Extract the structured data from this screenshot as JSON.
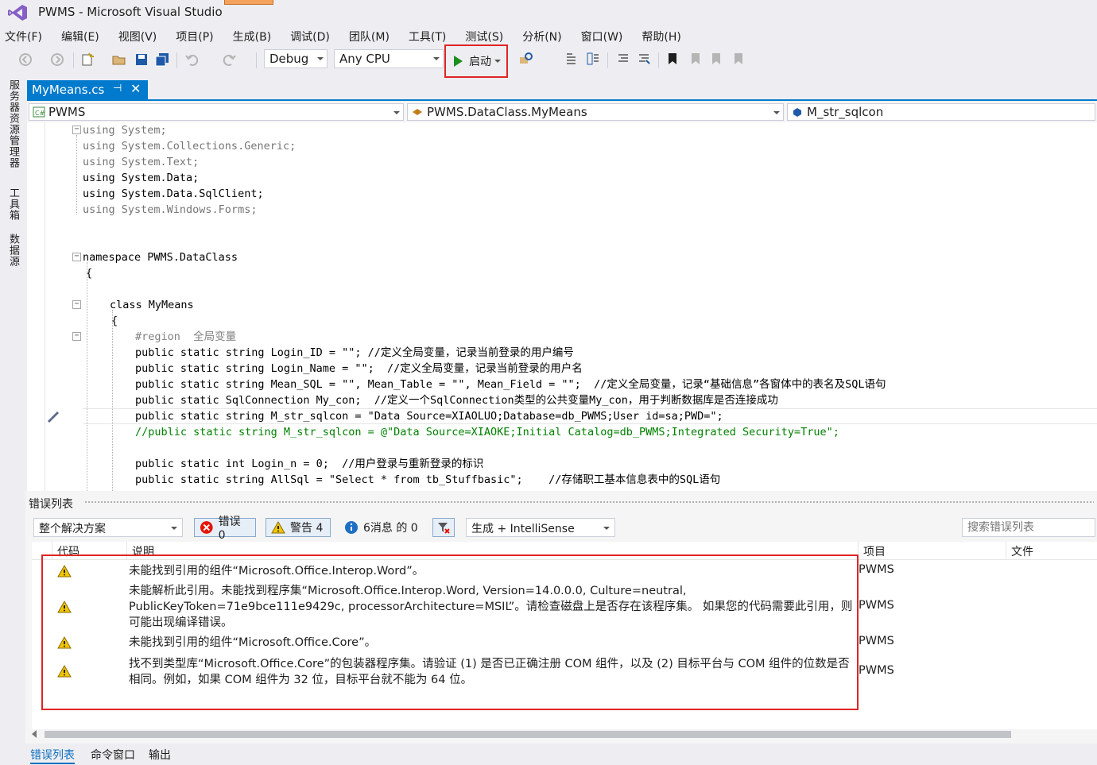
{
  "window": {
    "title": "PWMS - Microsoft Visual Studio"
  },
  "menu": [
    "文件(F)",
    "编辑(E)",
    "视图(V)",
    "项目(P)",
    "生成(B)",
    "调试(D)",
    "团队(M)",
    "工具(T)",
    "测试(S)",
    "分析(N)",
    "窗口(W)",
    "帮助(H)"
  ],
  "toolbar": {
    "configuration": "Debug",
    "platform": "Any CPU",
    "start_label": "启动"
  },
  "side_tabs": [
    "服务器资源管理器",
    "工具箱",
    "数据源"
  ],
  "document_tab": {
    "label": "MyMeans.cs"
  },
  "navbar": {
    "project": "PWMS",
    "type": "PWMS.DataClass.MyMeans",
    "member": "M_str_sqlcon"
  },
  "code": {
    "l1": "using System;",
    "l2": "using System.Collections.Generic;",
    "l3": "using System.Text;",
    "l4": "using System.Data;",
    "l5": "using System.Data.SqlClient;",
    "l6": "using System.Windows.Forms;",
    "l9": "namespace PWMS.DataClass",
    "l10": "{",
    "l12": "class MyMeans",
    "l13": "{",
    "l14": "#region  全局变量",
    "l15": "public static string Login_ID = \"\"; //定义全局变量，记录当前登录的用户编号",
    "l16": "public static string Login_Name = \"\";  //定义全局变量，记录当前登录的用户名",
    "l17": "public static string Mean_SQL = \"\", Mean_Table = \"\", Mean_Field = \"\";  //定义全局变量，记录“基础信息”各窗体中的表名及SQL语句",
    "l18": "public static SqlConnection My_con;  //定义一个SqlConnection类型的公共变量My_con，用于判断数据库是否连接成功",
    "l19": "public static string M_str_sqlcon = \"Data Source=XIAOLUO;Database=db_PWMS;User id=sa;PWD=\";",
    "l20": "//public static string M_str_sqlcon = @\"Data Source=XIAOKE;Initial Catalog=db_PWMS;Integrated Security=True\";",
    "l22": "public static int Login_n = 0;  //用户登录与重新登录的标识",
    "l23": "public static string AllSql = \"Select * from tb_Stuffbasic\";    //存储职工基本信息表中的SQL语句"
  },
  "error_list": {
    "title": "错误列表",
    "scope": "整个解决方案",
    "errors_label": "错误 0",
    "warnings_label": "警告 4",
    "messages_label": "6消息 的 0",
    "source": "生成 + IntelliSense",
    "search_placeholder": "搜索错误列表",
    "columns": {
      "code": "代码",
      "description": "说明",
      "project": "项目",
      "file": "文件"
    },
    "rows": [
      {
        "description": "未能找到引用的组件“Microsoft.Office.Interop.Word”。",
        "project": "PWMS"
      },
      {
        "description": "未能解析此引用。未能找到程序集“Microsoft.Office.Interop.Word, Version=14.0.0.0, Culture=neutral, PublicKeyToken=71e9bce111e9429c, processorArchitecture=MSIL”。请检查磁盘上是否存在该程序集。 如果您的代码需要此引用，则可能出现编译错误。",
        "project": "PWMS"
      },
      {
        "description": "未能找到引用的组件“Microsoft.Office.Core”。",
        "project": "PWMS"
      },
      {
        "description": "找不到类型库“Microsoft.Office.Core”的包装器程序集。请验证 (1) 是否已正确注册 COM 组件，以及 (2) 目标平台与 COM 组件的位数是否相同。例如，如果 COM 组件为 32 位，目标平台就不能为 64 位。",
        "project": "PWMS"
      }
    ]
  },
  "bottom_tabs": [
    "错误列表",
    "命令窗口",
    "输出"
  ],
  "colors": {
    "accent": "#007acc",
    "highlight_red": "#e02424",
    "warning": "#f2c500"
  }
}
